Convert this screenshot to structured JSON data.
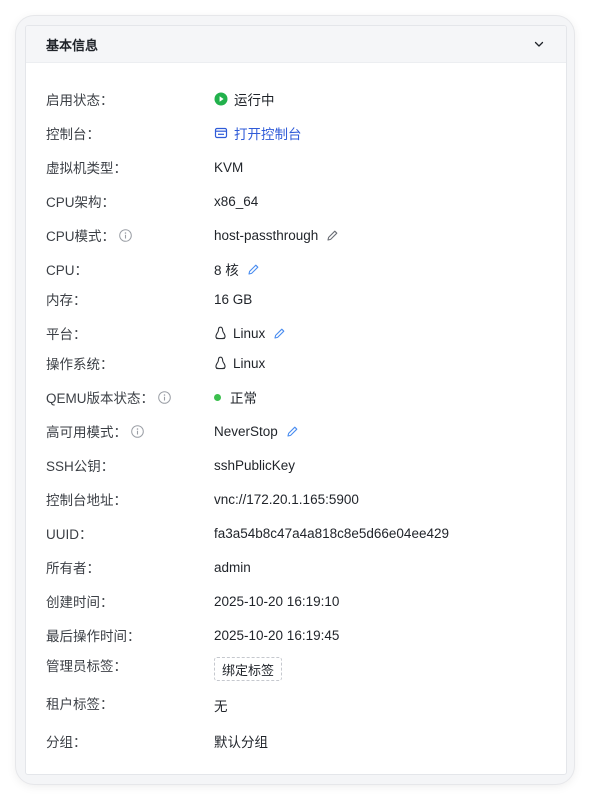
{
  "section": {
    "title": "基本信息"
  },
  "fields": {
    "status": {
      "label": "启用状态：",
      "value": "运行中",
      "color": "#22b14c"
    },
    "console": {
      "label": "控制台：",
      "value": "打开控制台",
      "color": "#2f5bd8"
    },
    "vm_type": {
      "label": "虚拟机类型：",
      "value": "KVM"
    },
    "cpu_arch": {
      "label": "CPU架构：",
      "value": "x86_64"
    },
    "cpu_mode": {
      "label": "CPU模式：",
      "value": "host-passthrough"
    },
    "cpu": {
      "label": "CPU：",
      "value": "8 核"
    },
    "memory": {
      "label": "内存：",
      "value": "16 GB"
    },
    "platform": {
      "label": "平台：",
      "value": "Linux"
    },
    "os": {
      "label": "操作系统：",
      "value": "Linux"
    },
    "qemu_status": {
      "label": "QEMU版本状态：",
      "value": "正常",
      "color": "#3cc04e"
    },
    "ha_mode": {
      "label": "高可用模式：",
      "value": "NeverStop"
    },
    "ssh_key": {
      "label": "SSH公钥：",
      "value": "sshPublicKey"
    },
    "console_addr": {
      "label": "控制台地址：",
      "value": "vnc://172.20.1.165:5900"
    },
    "uuid": {
      "label": "UUID：",
      "value": "fa3a54b8c47a4a818c8e5d66e04ee429"
    },
    "owner": {
      "label": "所有者：",
      "value": "admin"
    },
    "created": {
      "label": "创建时间：",
      "value": "2025-10-20 16:19:10"
    },
    "last_op": {
      "label": "最后操作时间：",
      "value": "2025-10-20 16:19:45"
    },
    "admin_tags": {
      "label": "管理员标签：",
      "button": "绑定标签"
    },
    "tenant_tags": {
      "label": "租户标签：",
      "value": "无"
    },
    "group": {
      "label": "分组：",
      "value": "默认分组"
    }
  },
  "icons": {
    "collapse": "chevron-down-icon",
    "status": "play-circle-icon",
    "console": "console-window-icon",
    "info": "info-circle-icon",
    "edit": "pencil-icon",
    "os": "linux-penguin-icon"
  },
  "colors": {
    "edit_active": "#4a8df0",
    "edit_inactive": "#6b6f76"
  }
}
